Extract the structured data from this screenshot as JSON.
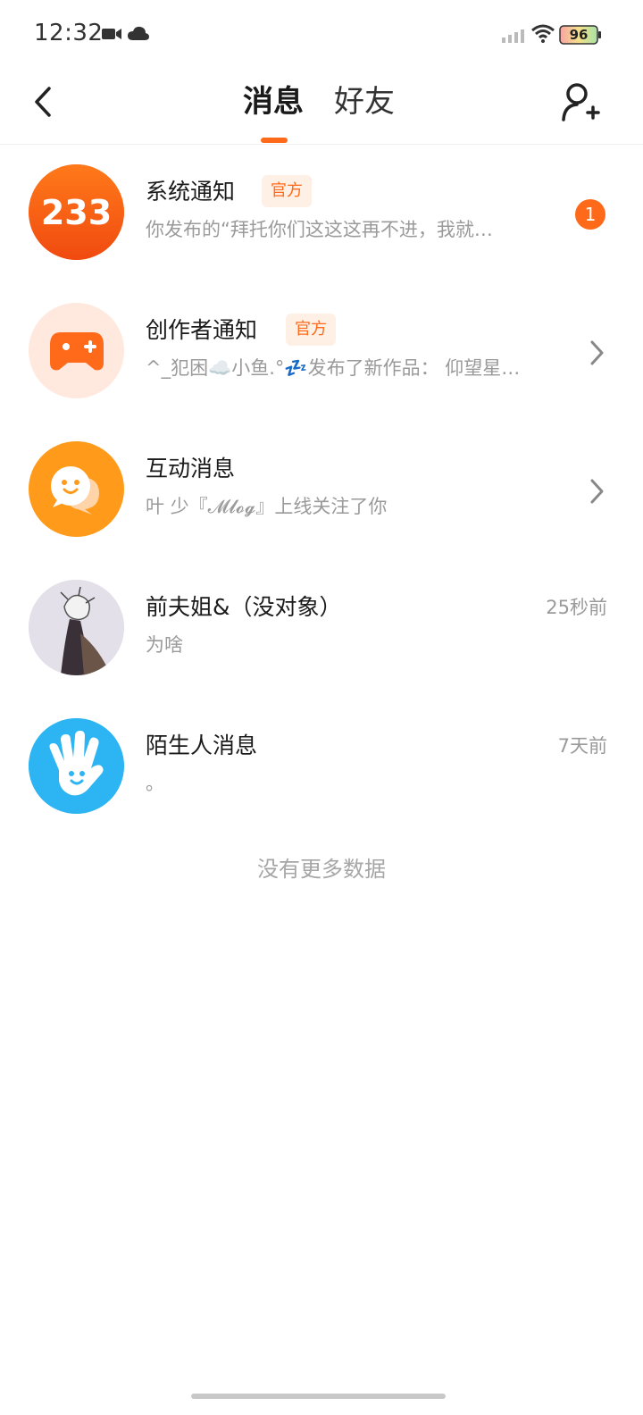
{
  "status_bar": {
    "time": "12:32",
    "battery": "96",
    "icons": [
      "video-camera-icon",
      "cloud-icon",
      "signal-icon",
      "wifi-icon",
      "battery-icon"
    ]
  },
  "header": {
    "tabs": [
      {
        "label": "消息",
        "active": true
      },
      {
        "label": "好友",
        "active": false
      }
    ],
    "icons": [
      "back-arrow-icon",
      "add-friend-icon"
    ]
  },
  "colors": {
    "accent": "#ff6a1a",
    "badge_bg": "#fff0e6",
    "muted_text": "#9a9a9a"
  },
  "conversations": [
    {
      "name": "系统通知",
      "badge": "官方",
      "preview": "你发布的“拜托你们这这这再不进，我就…",
      "unread": "1",
      "avatar": "233-logo"
    },
    {
      "name": "创作者通知",
      "badge": "官方",
      "preview": "^_犯困☁️小鱼.°💤发布了新作品： 仰望星…",
      "avatar": "gamepad-icon"
    },
    {
      "name": "互动消息",
      "preview": "叶 少『𝓜𝓵𝓸𝓰』上线关注了你",
      "avatar": "chat-bubble-icon"
    },
    {
      "name": "前夫姐&（没对象）",
      "preview": "为啥",
      "time": "25秒前",
      "avatar": "user-photo"
    },
    {
      "name": "陌生人消息",
      "preview": "。",
      "time": "7天前",
      "avatar": "wave-hand-icon"
    }
  ],
  "footer": {
    "no_more": "没有更多数据"
  }
}
